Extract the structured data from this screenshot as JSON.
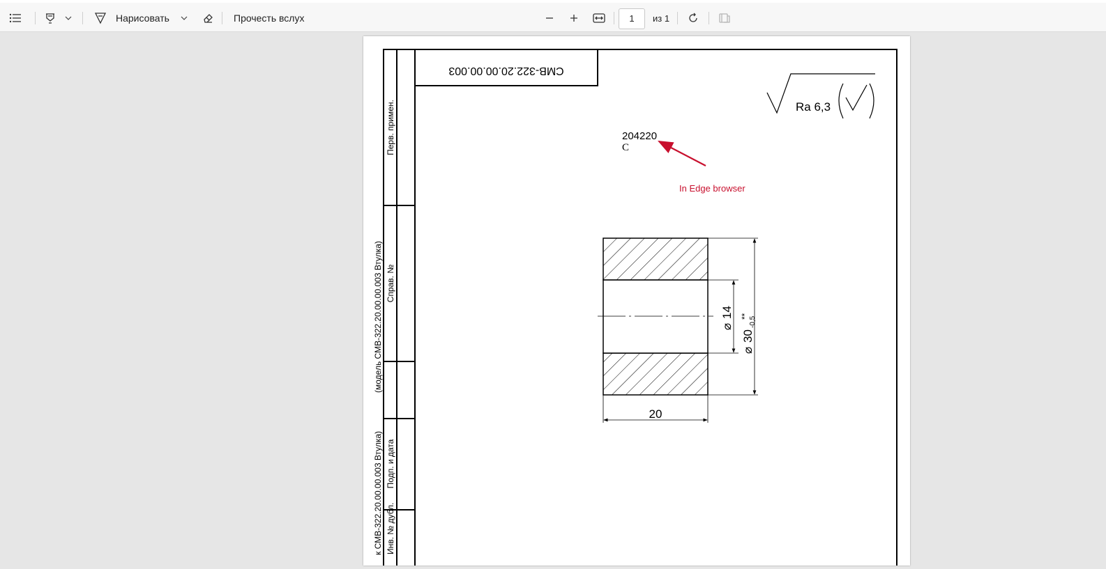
{
  "toolbar": {
    "draw_label": "Нарисовать",
    "read_aloud_label": "Прочесть вслух",
    "page_current": "1",
    "page_total_label": "из 1"
  },
  "drawing": {
    "designation": "СМВ-322.20.00.00.003",
    "roughness": "Ra 6,3",
    "stamp_number": "204220",
    "stamp_letter": "C",
    "annotation": "In Edge browser",
    "annotation_color": "#c8102e",
    "side_labels": {
      "perv_primen": "Перв. примен.",
      "sprav_no": "Справ. №",
      "podp_data": "Подп. и дата",
      "inv_dubl": "Инв. № дубл."
    },
    "side_caption": "(модель СМВ-322.20.00.00.003 Втулка)",
    "side_caption_2": "к СМВ-322.20.00.00.003 Втулка)",
    "dims": {
      "length": "20",
      "inner_symbol": "⌀",
      "inner_value": "14",
      "outer_symbol": "⌀",
      "outer_value": "30",
      "outer_tolerance": "-0,5",
      "outer_mark": "**"
    }
  }
}
